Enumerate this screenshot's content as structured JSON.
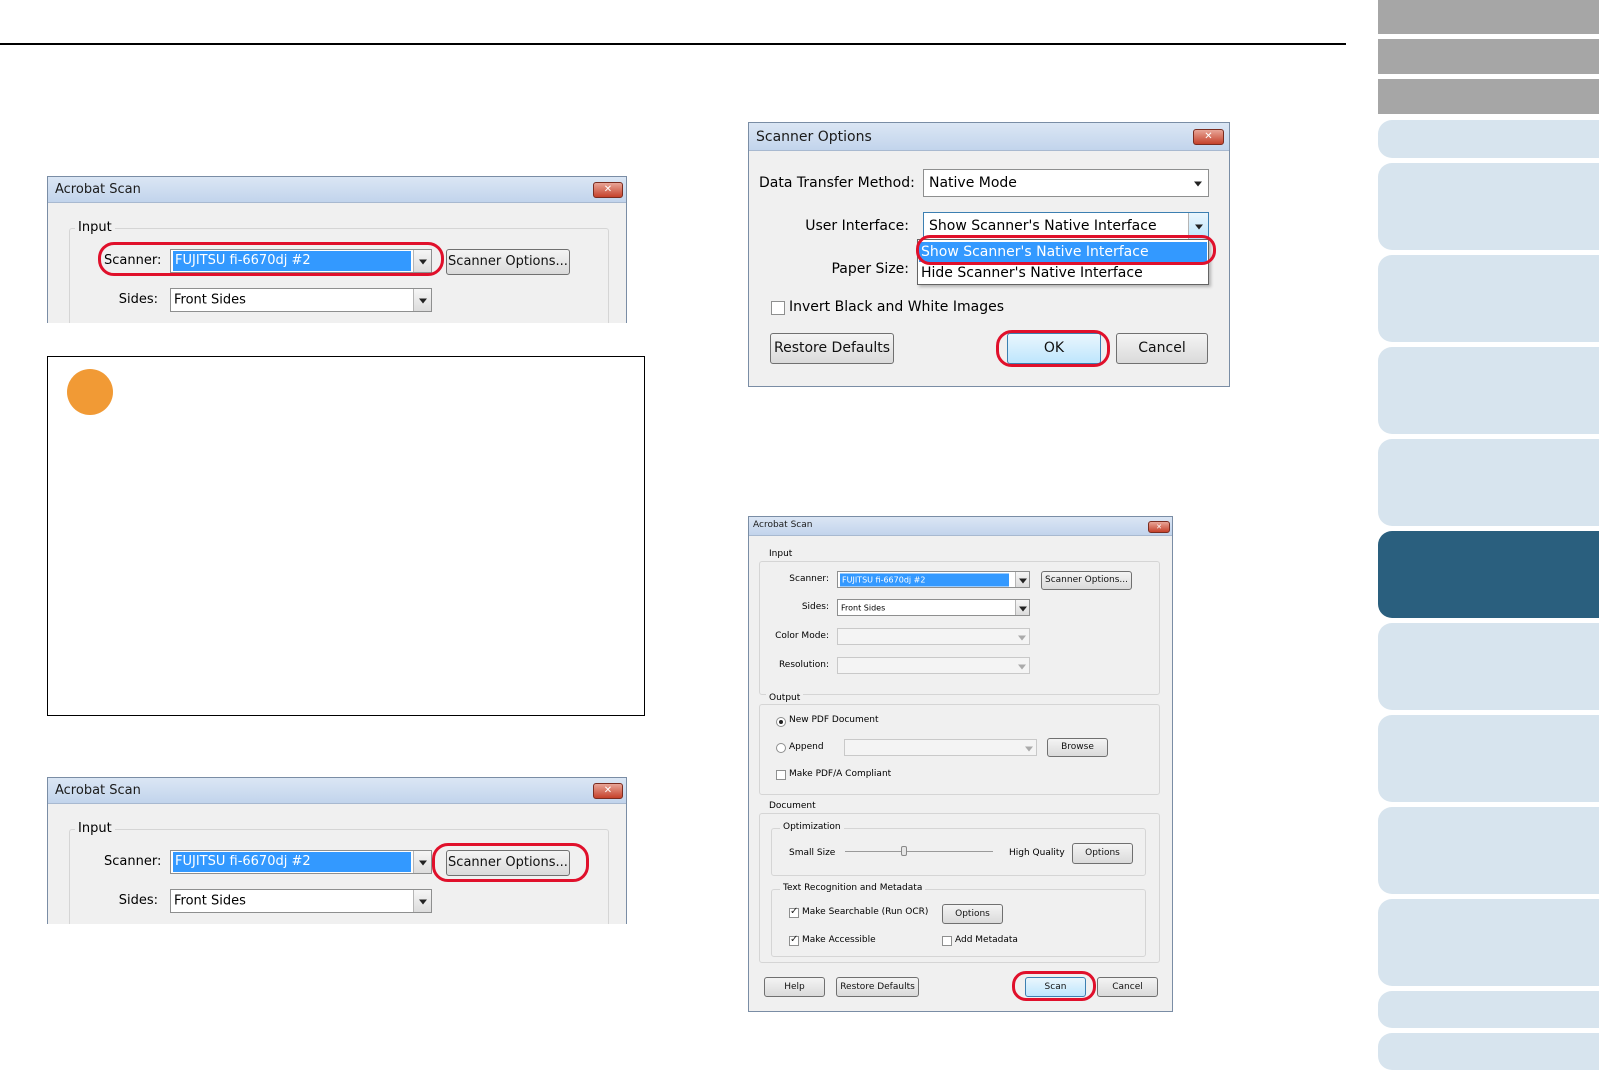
{
  "dialog1": {
    "title": "Acrobat Scan",
    "input_group": "Input",
    "scanner_label": "Scanner:",
    "scanner_value": "FUJITSU fi-6670dj #2",
    "scanner_options_button": "Scanner Options...",
    "sides_label": "Sides:",
    "sides_value": "Front Sides"
  },
  "dialog2": {
    "title": "Acrobat Scan",
    "input_group": "Input",
    "scanner_label": "Scanner:",
    "scanner_value": "FUJITSU fi-6670dj #2",
    "scanner_options_button": "Scanner Options...",
    "sides_label": "Sides:",
    "sides_value": "Front Sides"
  },
  "scanner_options": {
    "title": "Scanner Options",
    "data_transfer_label": "Data Transfer Method:",
    "data_transfer_value": "Native Mode",
    "user_interface_label": "User Interface:",
    "user_interface_value": "Show Scanner's Native Interface",
    "paper_size_label": "Paper Size:",
    "dropdown_options": [
      "Show Scanner's Native Interface",
      "Hide Scanner's Native Interface"
    ],
    "invert_label": "Invert Black and White Images",
    "restore_button": "Restore Defaults",
    "ok_button": "OK",
    "cancel_button": "Cancel"
  },
  "acrobat_full": {
    "title": "Acrobat Scan",
    "input_group": "Input",
    "scanner_label": "Scanner:",
    "scanner_value": "FUJITSU fi-6670dj #2",
    "scanner_options_button": "Scanner Options...",
    "sides_label": "Sides:",
    "sides_value": "Front Sides",
    "color_mode_label": "Color Mode:",
    "resolution_label": "Resolution:",
    "output_group": "Output",
    "new_pdf_label": "New PDF Document",
    "append_label": "Append",
    "browse_button": "Browse",
    "pdfa_label": "Make PDF/A Compliant",
    "document_group": "Document",
    "optimization_group": "Optimization",
    "small_size_label": "Small Size",
    "high_quality_label": "High Quality",
    "optimization_options_button": "Options",
    "ocr_group": "Text Recognition and Metadata",
    "make_searchable_label": "Make Searchable (Run OCR)",
    "ocr_options_button": "Options",
    "make_accessible_label": "Make Accessible",
    "add_metadata_label": "Add Metadata",
    "help_button": "Help",
    "restore_button": "Restore Defaults",
    "scan_button": "Scan",
    "cancel_button": "Cancel"
  },
  "close_glyph": "✕",
  "colors": {
    "highlight_ring": "#e0102b",
    "selection_blue": "#3399ff",
    "note_dot": "#f19a35",
    "active_tab": "#2a5f7e",
    "tab": "#d7e4ee",
    "gray_tab": "#a6a6a6"
  }
}
